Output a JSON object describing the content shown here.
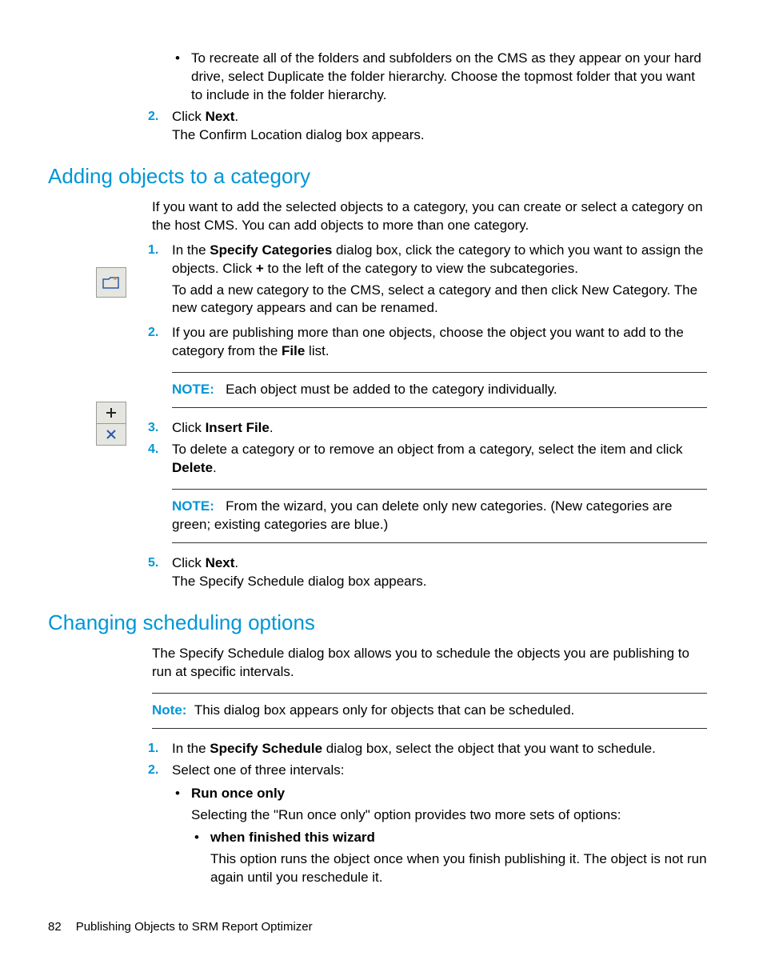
{
  "intro_bullet": "To recreate all of the folders and subfolders on the CMS as they appear on your hard drive, select Duplicate the folder hierarchy. Choose the topmost folder that you want to include in the folder hierarchy.",
  "step2a": {
    "num": "2.",
    "pre": "Click ",
    "bold": "Next",
    "post": "."
  },
  "step2a_sub": "The Confirm Location dialog box appears.",
  "heading1": "Adding objects to a category",
  "h1_intro": "If you want to add the selected objects to a category, you can create or select a category on the host CMS. You can add objects to more than one category.",
  "h1_s1": {
    "num": "1.",
    "t1": "In the ",
    "b1": "Specify Categories",
    "t2": " dialog box, click the category to which you want to assign the objects. Click ",
    "b2": "+",
    "t3": " to the left of the category to view the subcategories."
  },
  "h1_s1_extra": "To add a new category to the CMS, select a category and then click New Category. The new category appears and can be renamed.",
  "h1_s2": {
    "num": "2.",
    "t1": "If you are publishing more than one objects, choose the object you want to add to the category from the ",
    "b1": "File",
    "t2": " list."
  },
  "note1": {
    "label": "NOTE:",
    "text": "Each object must be added to the category individually."
  },
  "h1_s3": {
    "num": "3.",
    "t1": "Click ",
    "b1": "Insert File",
    "t2": "."
  },
  "h1_s4": {
    "num": "4.",
    "t1": "To delete a category or to remove an object from a category, select the item and click ",
    "b1": "Delete",
    "t2": "."
  },
  "note2": {
    "label": "NOTE:",
    "text": "From the wizard, you can delete only new categories. (New categories are green; existing categories are blue.)"
  },
  "h1_s5": {
    "num": "5.",
    "t1": "Click ",
    "b1": "Next",
    "t2": "."
  },
  "h1_s5_sub": "The Specify Schedule dialog box appears.",
  "heading2": "Changing scheduling options",
  "h2_intro": "The Specify Schedule dialog box allows you to schedule the objects you are publishing to run at specific intervals.",
  "note3": {
    "label": "Note:",
    "text": "This dialog box appears only for objects that can be scheduled."
  },
  "h2_s1": {
    "num": "1.",
    "t1": "In the ",
    "b1": "Specify Schedule",
    "t2": " dialog box, select the object that you want to schedule."
  },
  "h2_s2": {
    "num": "2.",
    "t1": "Select one of three intervals:"
  },
  "h2_b1": "Run once only",
  "h2_b1_sub": "Selecting the \"Run once only\" option provides two more sets of options:",
  "h2_b1_1": "when finished this wizard",
  "h2_b1_1_sub": "This option runs the object once when you finish publishing it. The object is not run again until you reschedule it.",
  "footer": {
    "page": "82",
    "title": "Publishing Objects to SRM Report Optimizer"
  }
}
